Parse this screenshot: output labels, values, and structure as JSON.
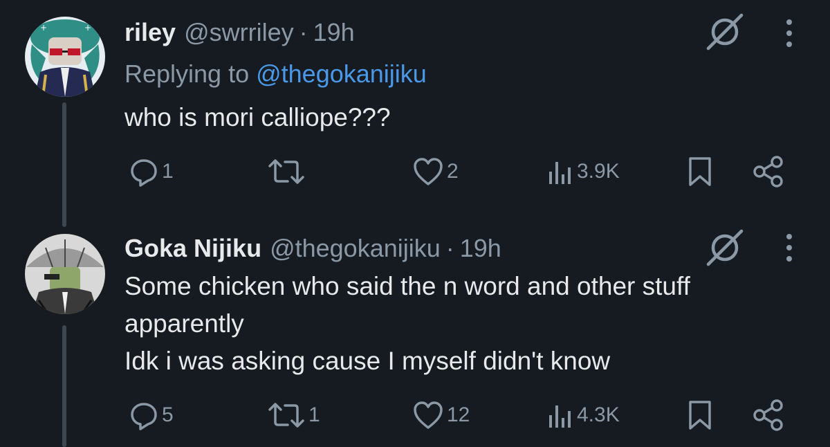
{
  "tweets": [
    {
      "display_name": "riley",
      "handle": "@swrriley",
      "separator": "·",
      "time": "19h",
      "replying_prefix": "Replying to ",
      "replying_to": "@thegokanijiku",
      "body_lines": [
        "who is mori calliope???"
      ],
      "reply_count": "1",
      "retweet_count": "",
      "like_count": "2",
      "view_count": "3.9K",
      "avatar_icon": "avatar-riley-icon"
    },
    {
      "display_name": "Goka Nijiku",
      "handle": "@thegokanijiku",
      "separator": "·",
      "time": "19h",
      "body_lines": [
        "Some chicken who said the n word and other stuff",
        "apparently",
        "Idk i was asking cause I myself didn't know"
      ],
      "reply_count": "5",
      "retweet_count": "1",
      "like_count": "12",
      "view_count": "4.3K",
      "avatar_icon": "avatar-goka-icon"
    }
  ],
  "colors": {
    "background": "#161b22",
    "primary_text": "#e7e9ea",
    "secondary_text": "#8b98a5",
    "link": "#4a99e9",
    "thread_line": "#3e4650"
  }
}
